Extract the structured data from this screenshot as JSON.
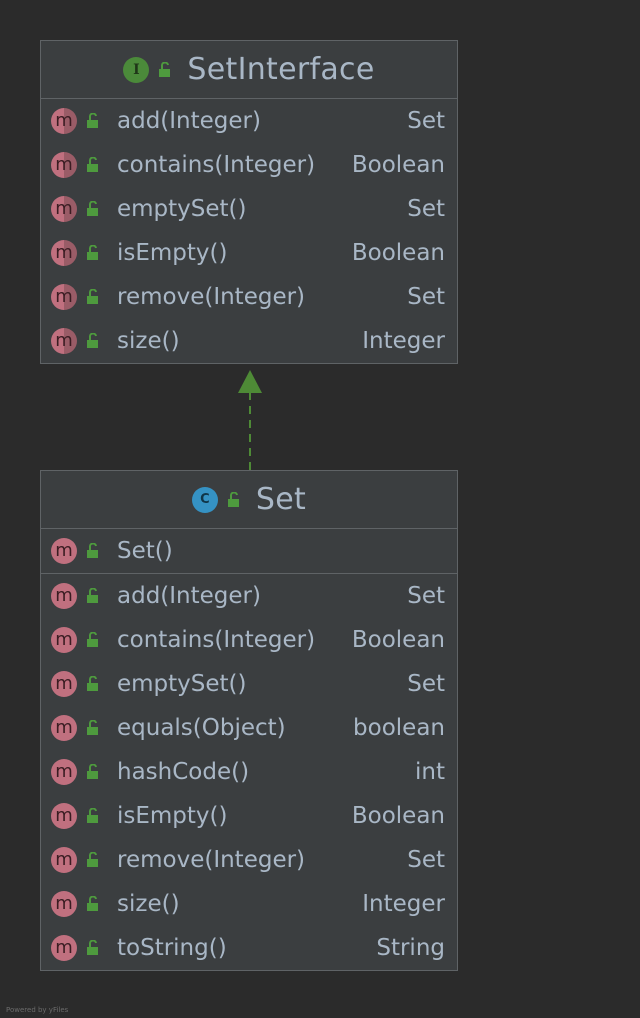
{
  "interface_box": {
    "kind_letter": "I",
    "title": "SetInterface",
    "methods": [
      {
        "name": "add(Integer)",
        "type": "Set"
      },
      {
        "name": "contains(Integer)",
        "type": "Boolean"
      },
      {
        "name": "emptySet()",
        "type": "Set"
      },
      {
        "name": "isEmpty()",
        "type": "Boolean"
      },
      {
        "name": "remove(Integer)",
        "type": "Set"
      },
      {
        "name": "size()",
        "type": "Integer"
      }
    ]
  },
  "class_box": {
    "kind_letter": "C",
    "title": "Set",
    "constructors": [
      {
        "name": "Set()",
        "type": ""
      }
    ],
    "methods": [
      {
        "name": "add(Integer)",
        "type": "Set"
      },
      {
        "name": "contains(Integer)",
        "type": "Boolean"
      },
      {
        "name": "emptySet()",
        "type": "Set"
      },
      {
        "name": "equals(Object)",
        "type": "boolean"
      },
      {
        "name": "hashCode()",
        "type": "int"
      },
      {
        "name": "isEmpty()",
        "type": "Boolean"
      },
      {
        "name": "remove(Integer)",
        "type": "Set"
      },
      {
        "name": "size()",
        "type": "Integer"
      },
      {
        "name": "toString()",
        "type": "String"
      }
    ]
  },
  "method_badge_letter": "m",
  "footer": "Powered by yFiles",
  "colors": {
    "background": "#2b2b2b",
    "box_fill": "#3b3e40",
    "box_border": "#5f6366",
    "text": "#a9b7c6",
    "interface_badge": "#4b8a3a",
    "class_badge": "#3592c4",
    "method_badge": "#c0707f",
    "lock_green": "#4e9a3e",
    "arrow_green": "#4e8a36"
  },
  "icons": {
    "visibility": "public-lock-icon",
    "method": "method-icon",
    "abstract_method": "abstract-method-icon",
    "interface": "interface-icon",
    "class": "class-icon",
    "relation": "realization-arrow"
  }
}
